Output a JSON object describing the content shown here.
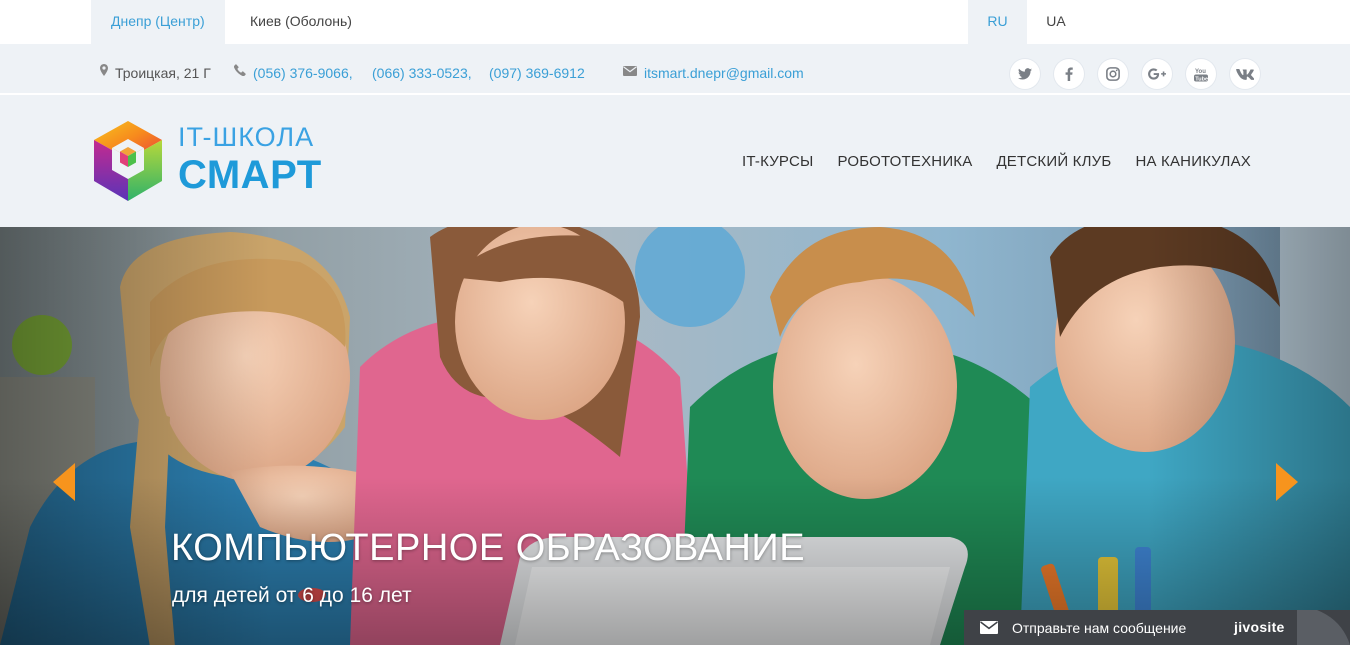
{
  "topbar": {
    "cities": [
      {
        "label": "Днепр (Центр)",
        "active": true
      },
      {
        "label": "Киев (Оболонь)",
        "active": false
      }
    ],
    "languages": [
      {
        "label": "RU",
        "active": true
      },
      {
        "label": "UA",
        "active": false
      }
    ]
  },
  "contacts": {
    "address": "Троицкая, 21 Г",
    "phones": [
      "(056) 376-9066,",
      "(066) 333-0523,",
      "(097) 369-6912"
    ],
    "email": "itsmart.dnepr@gmail.com",
    "social": [
      "twitter-icon",
      "facebook-icon",
      "instagram-icon",
      "google-plus-icon",
      "youtube-icon",
      "vk-icon"
    ]
  },
  "header": {
    "logo_top": "IT-ШКОЛА",
    "logo_bottom": "СМАРТ",
    "nav": [
      "IT-КУРСЫ",
      "РОБОТОТЕХНИКА",
      "ДЕТСКИЙ КЛУБ",
      "НА КАНИКУЛАХ"
    ]
  },
  "hero": {
    "title": "КОМПЬЮТЕРНОЕ ОБРАЗОВАНИЕ",
    "subtitle": "для детей от 6 до 16 лет",
    "accent_color": "#f7941d"
  },
  "chat": {
    "label": "Отправьте нам сообщение",
    "brand": "jivosite"
  },
  "colors": {
    "link": "#3a9fd6",
    "light_bg": "#eef2f6",
    "logo_blue": "#1e9ad9",
    "chat_bg": "#3f4247"
  }
}
